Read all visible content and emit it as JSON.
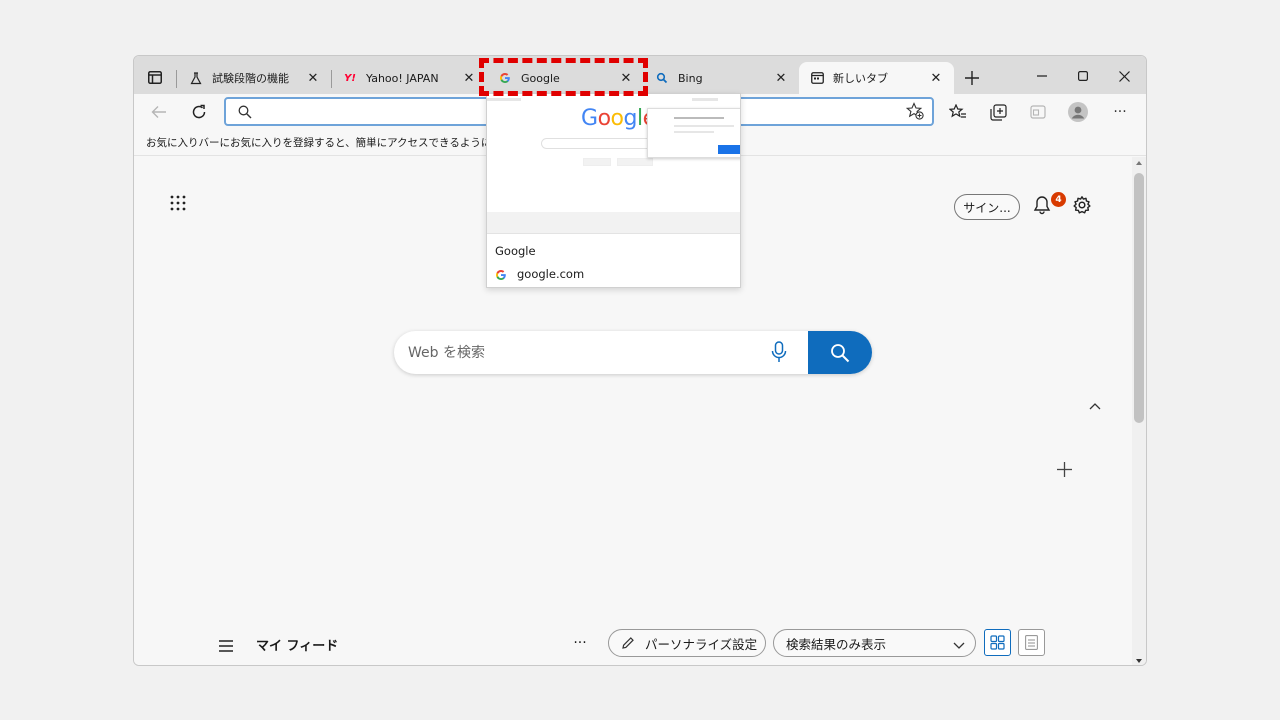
{
  "tabs": [
    {
      "label": "試験段階の機能",
      "icon": "flask-icon"
    },
    {
      "label": "Yahoo! JAPAN",
      "icon": "yahoo-icon"
    },
    {
      "label": "Google",
      "icon": "google-icon"
    },
    {
      "label": "Bing",
      "icon": "bing-search-icon"
    },
    {
      "label": "新しいタブ",
      "icon": "newtab-icon",
      "active": true
    }
  ],
  "address": {
    "value": "",
    "placeholder": ""
  },
  "favorites_bar": {
    "message": "お気に入りバーにお気に入りを登録すると、簡単にアクセスできるようになります。"
  },
  "ntp": {
    "signin_label": "サイン...",
    "notification_count": "4",
    "search_placeholder": "Web を検索"
  },
  "preview": {
    "title": "Google",
    "url": "google.com",
    "thumb_logo": "Google"
  },
  "feed": {
    "title": "マイ フィード",
    "more": "···",
    "personalize_label": "パーソナライズ設定",
    "filter_selected": "検索結果のみ表示"
  },
  "colors": {
    "accent": "#0f6cbd",
    "badge": "#d83b01",
    "highlight": "#e00000"
  }
}
